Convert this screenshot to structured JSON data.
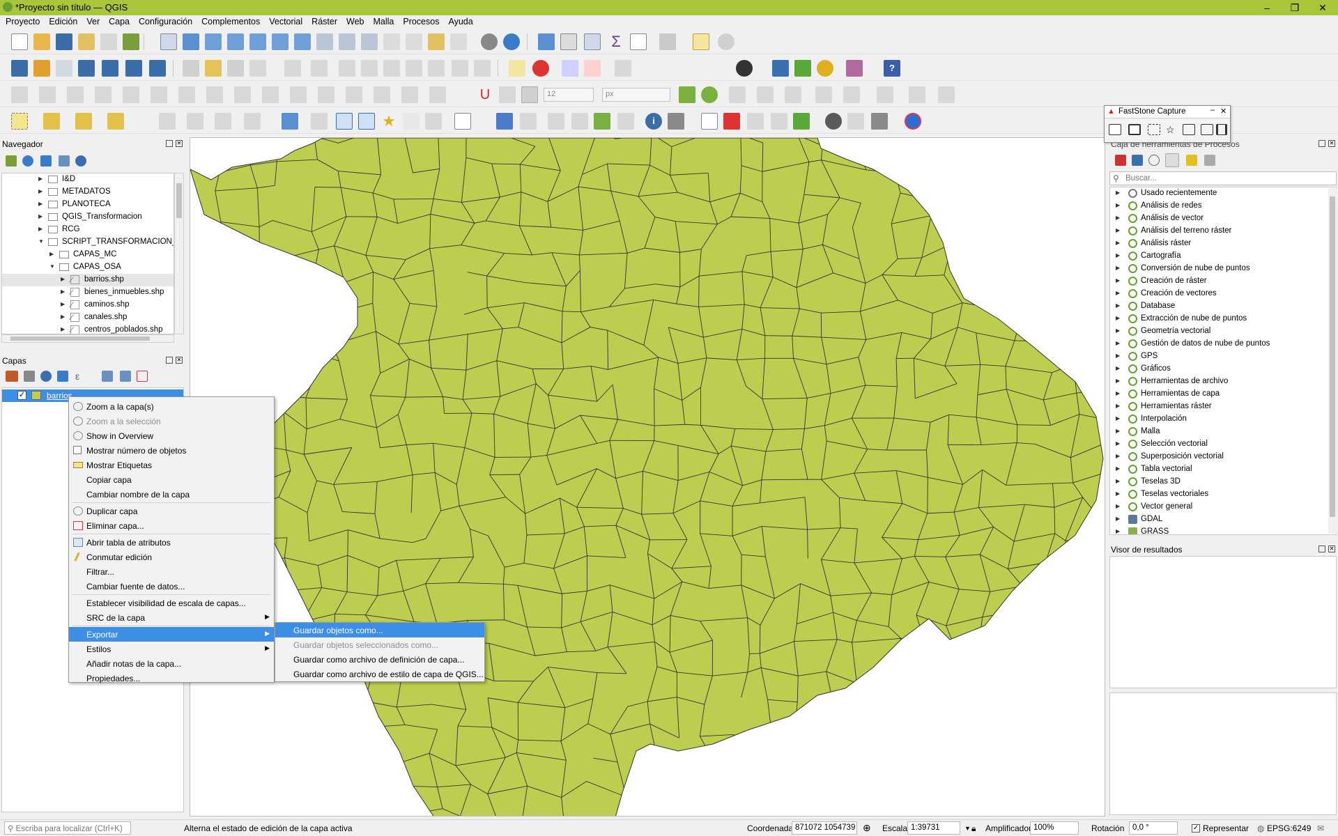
{
  "window": {
    "title": "*Proyecto sin título — QGIS",
    "min": "–",
    "max": "❐",
    "close": "✕"
  },
  "menubar": [
    "Proyecto",
    "Edición",
    "Ver",
    "Capa",
    "Configuración",
    "Complementos",
    "Vectorial",
    "Ráster",
    "Web",
    "Malla",
    "Procesos",
    "Ayuda"
  ],
  "toolbar": {
    "font_size": "12",
    "font_unit": "px"
  },
  "navegador": {
    "title": "Navegador",
    "items": [
      {
        "label": "I&D",
        "indent": 1,
        "type": "folder",
        "expanded": false
      },
      {
        "label": "METADATOS",
        "indent": 1,
        "type": "folder",
        "expanded": false
      },
      {
        "label": "PLANOTECA",
        "indent": 1,
        "type": "folder",
        "expanded": false
      },
      {
        "label": "QGIS_Transformacion",
        "indent": 1,
        "type": "folder",
        "expanded": false
      },
      {
        "label": "RCG",
        "indent": 1,
        "type": "folder",
        "expanded": false
      },
      {
        "label": "SCRIPT_TRANSFORMACION_CON",
        "indent": 1,
        "type": "folder",
        "expanded": true
      },
      {
        "label": "CAPAS_MC",
        "indent": 2,
        "type": "folder",
        "expanded": false
      },
      {
        "label": "CAPAS_OSA",
        "indent": 2,
        "type": "folder",
        "expanded": true
      },
      {
        "label": "barrios.shp",
        "indent": 3,
        "type": "shp",
        "selected": true
      },
      {
        "label": "bienes_inmuebles.shp",
        "indent": 3,
        "type": "shp"
      },
      {
        "label": "caminos.shp",
        "indent": 3,
        "type": "shp"
      },
      {
        "label": "canales.shp",
        "indent": 3,
        "type": "shp"
      },
      {
        "label": "centros_poblados.shp",
        "indent": 3,
        "type": "shp"
      }
    ]
  },
  "capas": {
    "title": "Capas",
    "layer": "barrios",
    "fill_color": "#bccd4f"
  },
  "context_menu": {
    "items": [
      {
        "label": "Zoom a la capa(s)",
        "icon": "zoom-layer-icon"
      },
      {
        "label": "Zoom a la selección",
        "disabled": true,
        "icon": "zoom-selection-icon"
      },
      {
        "label": "Show in Overview",
        "icon": "overview-icon"
      },
      {
        "label": "Mostrar número de objetos",
        "icon": "checkbox-icon"
      },
      {
        "label": "Mostrar Etiquetas",
        "icon": "labels-icon"
      },
      {
        "label": "Copiar capa"
      },
      {
        "label": "Cambiar nombre de la capa",
        "sep_after": true
      },
      {
        "label": "Duplicar capa",
        "icon": "duplicate-icon"
      },
      {
        "label": "Eliminar capa...",
        "icon": "remove-layer-icon",
        "sep_after": true
      },
      {
        "label": "Abrir tabla de atributos",
        "icon": "attribute-table-icon"
      },
      {
        "label": "Conmutar edición",
        "icon": "pencil-icon"
      },
      {
        "label": "Filtrar..."
      },
      {
        "label": "Cambiar fuente de datos...",
        "sep_after": true
      },
      {
        "label": "Establecer visibilidad de escala de capas..."
      },
      {
        "label": "SRC de la capa",
        "submenu": true,
        "sep_after": true
      },
      {
        "label": "Exportar",
        "submenu": true,
        "highlight": true
      },
      {
        "label": "Estilos",
        "submenu": true
      },
      {
        "label": "Añadir notas de la capa..."
      },
      {
        "label": "Propiedades..."
      }
    ]
  },
  "submenu": {
    "items": [
      {
        "label": "Guardar objetos como...",
        "highlight": true
      },
      {
        "label": "Guardar objetos seleccionados como...",
        "disabled": true
      },
      {
        "label": "Guardar como archivo de definición de capa..."
      },
      {
        "label": "Guardar como archivo de estilo de capa de QGIS..."
      }
    ]
  },
  "faststone": {
    "title": "FastStone Capture"
  },
  "procesos": {
    "title": "Caja de herramientas de Procesos",
    "search_placeholder": "Buscar...",
    "items": [
      "Usado recientemente",
      "Análisis de redes",
      "Análisis de vector",
      "Análisis del terreno ráster",
      "Análisis ráster",
      "Cartografía",
      "Conversión de nube de puntos",
      "Creación de ráster",
      "Creación de vectores",
      "Database",
      "Extracción de nube de puntos",
      "Geometría vectorial",
      "Gestión de datos de nube de puntos",
      "GPS",
      "Gráficos",
      "Herramientas de archivo",
      "Herramientas de capa",
      "Herramientas ráster",
      "Interpolación",
      "Malla",
      "Selección vectorial",
      "Superposición vectorial",
      "Tabla vectorial",
      "Teselas 3D",
      "Teselas vectoriales",
      "Vector general",
      "GDAL",
      "GRASS"
    ]
  },
  "visor": {
    "title": "Visor de resultados"
  },
  "status": {
    "locate_placeholder": "Escriba para localizar (Ctrl+K)",
    "message": "Alterna el estado de edición de la capa activa",
    "coord_label": "Coordenada",
    "coord_value": "871072  1054739",
    "scale_label": "Escala",
    "scale_value": "1:39731",
    "magnifier_label": "Amplificador",
    "magnifier_value": "100%",
    "rotation_label": "Rotación",
    "rotation_value": "0,0 °",
    "render_label": "Representar",
    "crs": "EPSG:6249"
  }
}
